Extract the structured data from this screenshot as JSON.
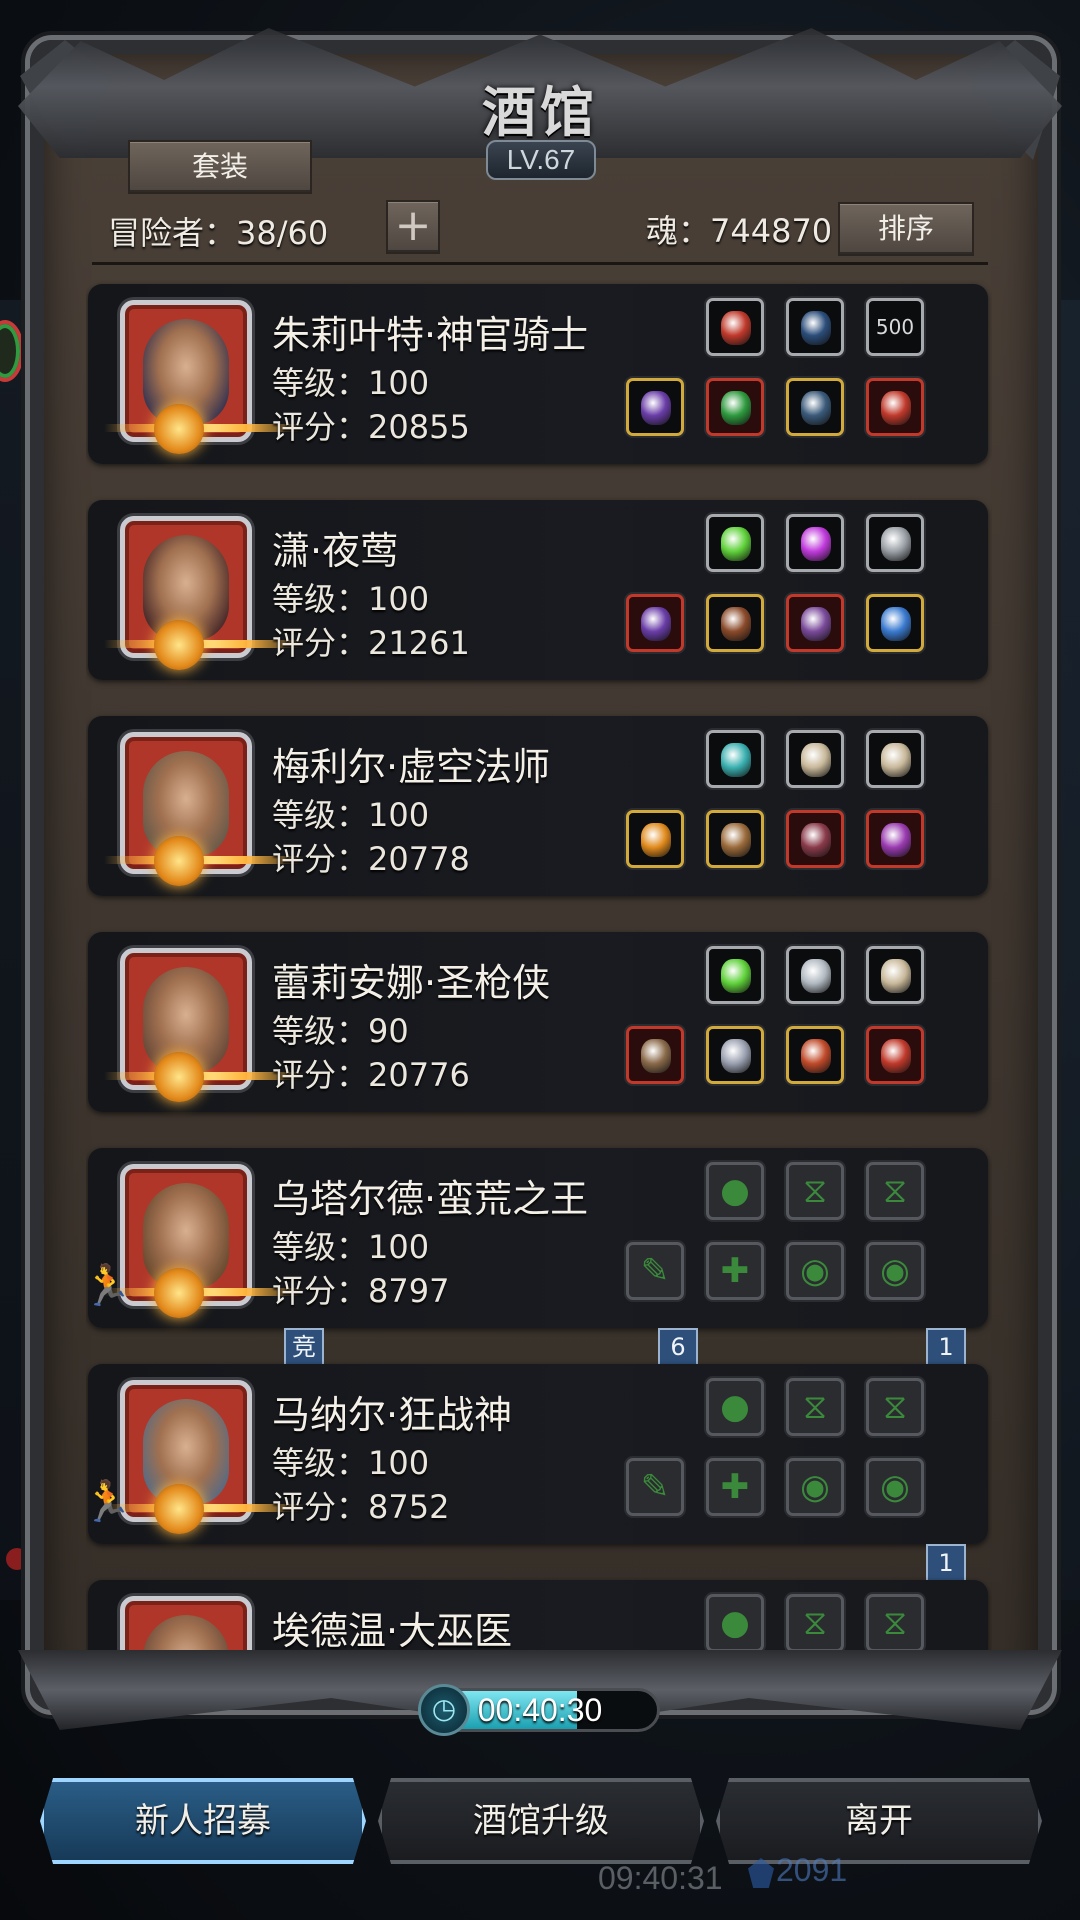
{
  "title": "酒馆",
  "level_badge": "LV.67",
  "set_button": "套装",
  "adventurers": "冒险者：38/60",
  "add_icon": "plus-icon",
  "soul": "魂：744870",
  "sort_button": "排序",
  "heroes": [
    {
      "name": "朱莉叶特·神官骑士",
      "level": "等级：100",
      "score": "评分：20855",
      "portrait_color": "#3b3550",
      "top_slots": [
        {
          "icon": "red-heart-gem",
          "color": "#c0392b",
          "frame": "normal"
        },
        {
          "icon": "bow-icon",
          "color": "#2b4d7a",
          "frame": "normal"
        },
        {
          "icon": "500-medal",
          "color": "#555",
          "frame": "normal",
          "text": "500"
        }
      ],
      "bottom_slots": [
        {
          "icon": "staff-icon",
          "color": "#6a3da8",
          "frame": "gold"
        },
        {
          "icon": "green-armor",
          "color": "#2e9a3e",
          "frame": "red"
        },
        {
          "icon": "knight-armor",
          "color": "#3a5a7a",
          "frame": "gold"
        },
        {
          "icon": "red-amulet",
          "color": "#c0392b",
          "frame": "red"
        }
      ]
    },
    {
      "name": "潇·夜莺",
      "level": "等级：100",
      "score": "评分：21261",
      "portrait_color": "#4a2a2a",
      "top_slots": [
        {
          "icon": "green-crystal",
          "color": "#5fd13a",
          "frame": "normal"
        },
        {
          "icon": "purple-gem",
          "color": "#c03adc",
          "frame": "normal"
        },
        {
          "icon": "silver-crest",
          "color": "#9aa0a6",
          "frame": "normal"
        }
      ],
      "bottom_slots": [
        {
          "icon": "purple-dagger",
          "color": "#6a3da8",
          "frame": "red"
        },
        {
          "icon": "leather-armor",
          "color": "#8a4a2a",
          "frame": "gold"
        },
        {
          "icon": "demon-helm",
          "color": "#7a4a9a",
          "frame": "red"
        },
        {
          "icon": "blue-amulet",
          "color": "#3a7ad0",
          "frame": "gold"
        }
      ]
    },
    {
      "name": "梅利尔·虚空法师",
      "level": "等级：100",
      "score": "评分：20778",
      "portrait_color": "#6a5a4a",
      "top_slots": [
        {
          "icon": "teal-orb",
          "color": "#3ab0b0",
          "frame": "normal"
        },
        {
          "icon": "bone-wand",
          "color": "#c8b89a",
          "frame": "normal"
        },
        {
          "icon": "bone-wand",
          "color": "#c8b89a",
          "frame": "normal"
        }
      ],
      "bottom_slots": [
        {
          "icon": "fire-staff",
          "color": "#e08a1c",
          "frame": "gold"
        },
        {
          "icon": "bronze-armor",
          "color": "#9a6a3a",
          "frame": "gold"
        },
        {
          "icon": "spiked-armor",
          "color": "#8a3a4a",
          "frame": "red"
        },
        {
          "icon": "purple-amulet",
          "color": "#9a3ab0",
          "frame": "red"
        }
      ]
    },
    {
      "name": "蕾莉安娜·圣枪侠",
      "level": "等级：90",
      "score": "评分：20776",
      "portrait_color": "#6a4a3a",
      "top_slots": [
        {
          "icon": "green-crystal",
          "color": "#5fd13a",
          "frame": "normal"
        },
        {
          "icon": "curved-blade",
          "color": "#b0b8c0",
          "frame": "normal"
        },
        {
          "icon": "bone-wand",
          "color": "#c8b89a",
          "frame": "normal"
        }
      ],
      "bottom_slots": [
        {
          "icon": "rifle-icon",
          "color": "#8a6a4a",
          "frame": "red"
        },
        {
          "icon": "plate-armor",
          "color": "#9aa0b0",
          "frame": "gold"
        },
        {
          "icon": "heart-amulet",
          "color": "#c04a2a",
          "frame": "gold"
        },
        {
          "icon": "ring-icon",
          "color": "#c0392b",
          "frame": "red"
        }
      ]
    },
    {
      "name": "乌塔尔德·蛮荒之王",
      "level": "等级：100",
      "score": "评分：8797",
      "portrait_color": "#6a4a30",
      "runner": true,
      "top_slots": [
        {
          "icon": "empty-crystal-slot",
          "frame": "empty",
          "glyph": "●"
        },
        {
          "icon": "empty-hourglass-slot",
          "frame": "empty",
          "glyph": "⧖"
        },
        {
          "icon": "empty-hourglass-slot",
          "frame": "empty",
          "glyph": "⧖"
        }
      ],
      "bottom_slots": [
        {
          "icon": "empty-weapon-slot",
          "frame": "empty",
          "glyph": "✎"
        },
        {
          "icon": "empty-armor-slot",
          "frame": "empty",
          "glyph": "✚"
        },
        {
          "icon": "empty-ring-slot",
          "frame": "empty",
          "glyph": "◉"
        },
        {
          "icon": "empty-ring-slot",
          "frame": "empty",
          "glyph": "◉"
        }
      ],
      "tags": [
        {
          "text": "竞",
          "pos": "left"
        },
        {
          "text": "6",
          "pos": "mid"
        },
        {
          "text": "1",
          "pos": "right"
        }
      ]
    },
    {
      "name": "马纳尔·狂战神",
      "level": "等级：100",
      "score": "评分：8752",
      "portrait_color": "#5a6a80",
      "runner": true,
      "top_slots": [
        {
          "icon": "empty-crystal-slot",
          "frame": "empty",
          "glyph": "●"
        },
        {
          "icon": "empty-hourglass-slot",
          "frame": "empty",
          "glyph": "⧖"
        },
        {
          "icon": "empty-hourglass-slot",
          "frame": "empty",
          "glyph": "⧖"
        }
      ],
      "bottom_slots": [
        {
          "icon": "empty-weapon-slot",
          "frame": "empty",
          "glyph": "✎"
        },
        {
          "icon": "empty-armor-slot",
          "frame": "empty",
          "glyph": "✚"
        },
        {
          "icon": "empty-ring-slot",
          "frame": "empty",
          "glyph": "◉"
        },
        {
          "icon": "empty-ring-slot",
          "frame": "empty",
          "glyph": "◉"
        }
      ],
      "tags": [
        {
          "text": "1",
          "pos": "right"
        }
      ]
    },
    {
      "name": "埃德温·大巫医",
      "level": "",
      "score": "",
      "portrait_color": "#6a4a3a",
      "top_slots": [
        {
          "icon": "empty-crystal-slot",
          "frame": "empty",
          "glyph": "●"
        },
        {
          "icon": "empty-hourglass-slot",
          "frame": "empty",
          "glyph": "⧖"
        },
        {
          "icon": "empty-hourglass-slot",
          "frame": "empty",
          "glyph": "⧖"
        }
      ],
      "bottom_slots": []
    }
  ],
  "timer": {
    "text": "00:40:30",
    "progress": 0.66,
    "icon": "clock-icon"
  },
  "bottom_buttons": {
    "recruit": "新人招募",
    "upgrade": "酒馆升级",
    "leave": "离开"
  },
  "hud": {
    "clock": "09:40:31",
    "gems": "2091"
  }
}
